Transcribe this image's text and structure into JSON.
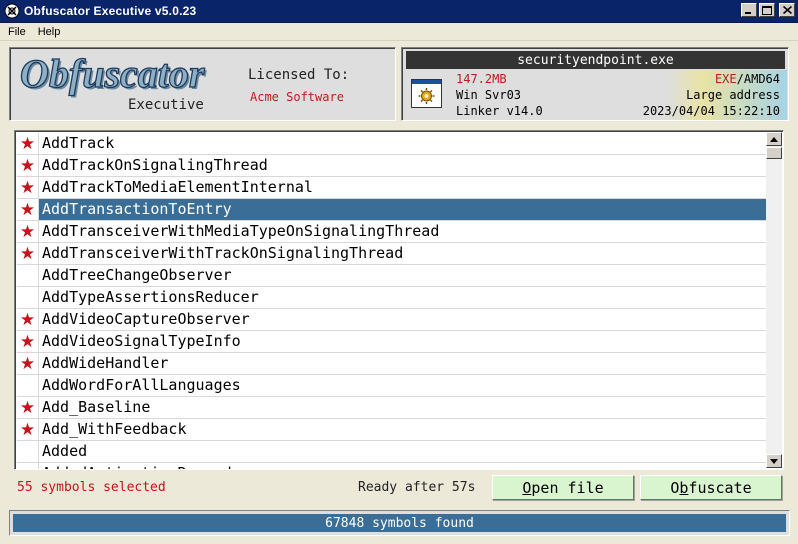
{
  "window": {
    "title": "Obfuscator Executive v5.0.23"
  },
  "menu": [
    "File",
    "Help"
  ],
  "brand": {
    "logo_text": "Obfuscator",
    "edition": "Executive",
    "licensed_label": "Licensed To:",
    "licensee": "Acme Software"
  },
  "file_info": {
    "filename": "securityendpoint.exe",
    "size": "147.2MB",
    "os": "Win Svr03",
    "linker": "Linker v14.0",
    "type_exe": "EXE",
    "type_arch": "/AMD64",
    "address": "Large address",
    "timestamp": "2023/04/04 15:22:10"
  },
  "symbols": [
    {
      "name": "AddTrack",
      "marked": true,
      "selected": false
    },
    {
      "name": "AddTrackOnSignalingThread",
      "marked": true,
      "selected": false
    },
    {
      "name": "AddTrackToMediaElementInternal",
      "marked": true,
      "selected": false
    },
    {
      "name": "AddTransactionToEntry",
      "marked": true,
      "selected": true
    },
    {
      "name": "AddTransceiverWithMediaTypeOnSignalingThread",
      "marked": true,
      "selected": false
    },
    {
      "name": "AddTransceiverWithTrackOnSignalingThread",
      "marked": true,
      "selected": false
    },
    {
      "name": "AddTreeChangeObserver",
      "marked": false,
      "selected": false
    },
    {
      "name": "AddTypeAssertionsReducer",
      "marked": false,
      "selected": false
    },
    {
      "name": "AddVideoCaptureObserver",
      "marked": true,
      "selected": false
    },
    {
      "name": "AddVideoSignalTypeInfo",
      "marked": true,
      "selected": false
    },
    {
      "name": "AddWideHandler",
      "marked": true,
      "selected": false
    },
    {
      "name": "AddWordForAllLanguages",
      "marked": false,
      "selected": false
    },
    {
      "name": "Add_Baseline",
      "marked": true,
      "selected": false
    },
    {
      "name": "Add_WithFeedback",
      "marked": true,
      "selected": false
    },
    {
      "name": "Added",
      "marked": false,
      "selected": false
    },
    {
      "name": "AddedActivationRecord",
      "marked": false,
      "selected": false
    }
  ],
  "mark_glyph": "★",
  "footer": {
    "selected_count": "55 symbols selected",
    "ready": "Ready after 57s",
    "open_button_prefix": "",
    "open_button_underlined": "O",
    "open_button_rest": "pen file",
    "obf_button_prefix": "O",
    "obf_button_underlined": "b",
    "obf_button_rest": "fuscate",
    "status": "67848 symbols found"
  },
  "colors": {
    "titlebar": "#0a246a",
    "selection": "#3a6e96",
    "mark": "#c0161c",
    "button_face": "#d8f5cf"
  }
}
